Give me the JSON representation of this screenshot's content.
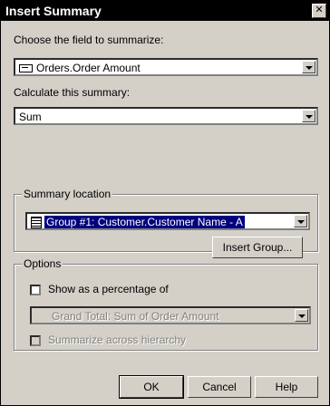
{
  "dialog": {
    "title": "Insert Summary",
    "close_glyph": "✕"
  },
  "field_section": {
    "label": "Choose the field to summarize:",
    "selected": "Orders.Order Amount"
  },
  "calc_section": {
    "label": "Calculate this summary:",
    "selected": "Sum"
  },
  "location": {
    "legend": "Summary location",
    "selected": "Group #1: Customer.Customer Name - A",
    "insert_group_label": "Insert Group..."
  },
  "options": {
    "legend": "Options",
    "percent_label": "Show as a percentage of",
    "percent_checked": false,
    "percent_combo": "Grand Total: Sum of Order Amount",
    "hierarchy_label": "Summarize across hierarchy",
    "hierarchy_checked": false
  },
  "buttons": {
    "ok": "OK",
    "cancel": "Cancel",
    "help": "Help"
  }
}
